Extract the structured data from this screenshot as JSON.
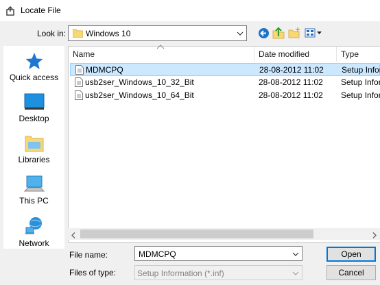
{
  "window": {
    "title": "Locate File"
  },
  "toolbar": {
    "look_in_label": "Look in:",
    "look_in_value": "Windows 10",
    "back_icon": "back-arrow-icon",
    "up_icon": "up-folder-icon",
    "new_folder_icon": "new-folder-icon",
    "view_icon": "view-menu-icon"
  },
  "places": [
    {
      "label": "Quick access",
      "icon": "star-icon"
    },
    {
      "label": "Desktop",
      "icon": "desktop-icon"
    },
    {
      "label": "Libraries",
      "icon": "libraries-icon"
    },
    {
      "label": "This PC",
      "icon": "computer-icon"
    },
    {
      "label": "Network",
      "icon": "network-icon"
    }
  ],
  "columns": [
    "Name",
    "Date modified",
    "Type"
  ],
  "files": [
    {
      "name": "MDMCPQ",
      "date": "28-08-2012 11:02",
      "type": "Setup Information",
      "selected": true
    },
    {
      "name": "usb2ser_Windows_10_32_Bit",
      "date": "28-08-2012 11:02",
      "type": "Setup Information",
      "selected": false
    },
    {
      "name": "usb2ser_Windows_10_64_Bit",
      "date": "28-08-2012 11:02",
      "type": "Setup Information",
      "selected": false
    }
  ],
  "footer": {
    "file_name_label": "File name:",
    "file_name_value": "MDMCPQ",
    "file_type_label": "Files of type:",
    "file_type_value": "Setup Information (*.inf)",
    "open_label": "Open",
    "cancel_label": "Cancel"
  },
  "colors": {
    "selection": "#cce8ff",
    "accent": "#0078d7"
  }
}
